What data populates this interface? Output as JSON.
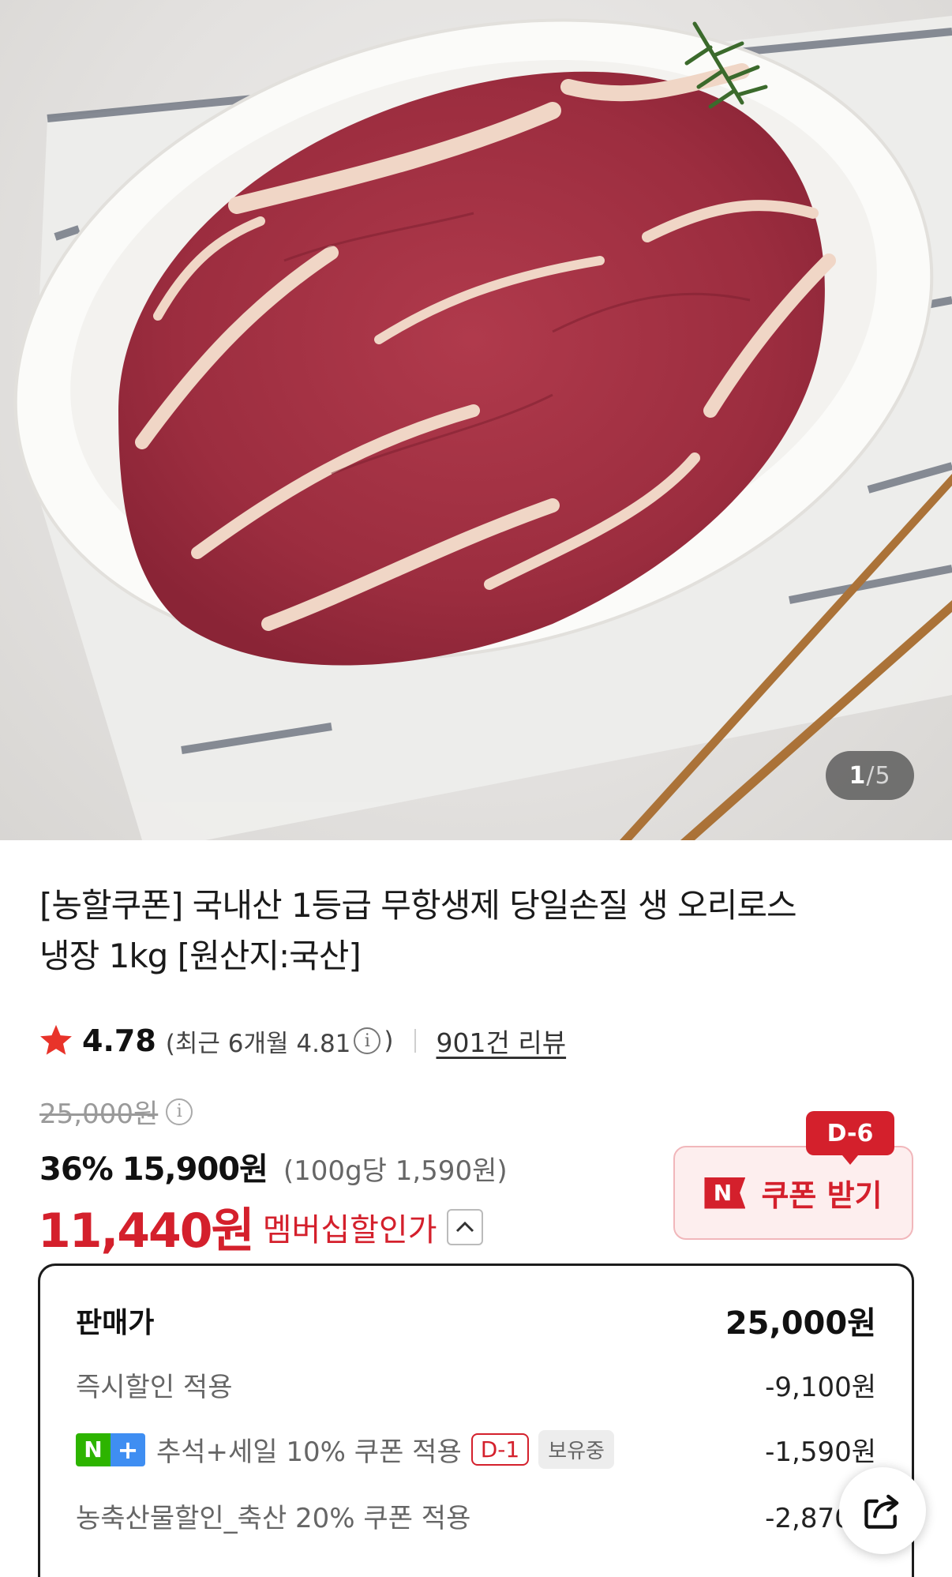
{
  "gallery": {
    "current": "1",
    "separator": "/",
    "total": "5"
  },
  "product": {
    "title_line1": "[농할쿠폰] 국내산 1등급 무항생제 당일손질 생 오리로스",
    "title_line2": "냉장 1kg [원산지:국산]"
  },
  "rating": {
    "score": "4.78",
    "recent_prefix": "(최근 6개월 4.81",
    "recent_suffix": ")",
    "info_glyph": "i",
    "reviews": "901건 리뷰"
  },
  "price": {
    "original": "25,000원",
    "discount_pct": "36%",
    "sale_price": "15,900원",
    "unit_price": "(100g당 1,590원)",
    "member_price": "11,440원",
    "member_label": "멤버십할인가"
  },
  "coupon": {
    "badge": "D-6",
    "logo": "N",
    "label": "쿠폰 받기"
  },
  "breakdown": {
    "rows": [
      {
        "label": "판매가",
        "value": "25,000원"
      },
      {
        "label": "즉시할인 적용",
        "value": "-9,100원"
      },
      {
        "label": "추석+세일 10% 쿠폰 적용",
        "value": "-1,590원",
        "badge": "D-1",
        "status": "보유중",
        "logo_n": "N",
        "logo_plus": "+"
      },
      {
        "label": "농축산물할인_축산 20% 쿠폰 적용",
        "value": "-2,870원"
      }
    ]
  },
  "colors": {
    "accent_red": "#d4202c",
    "star": "#e8332a",
    "naver_green": "#2db400",
    "plus_blue": "#3f8ef2"
  },
  "icons": {
    "rating": "star-icon",
    "info": "info-icon",
    "collapse": "chevron-up-icon",
    "share": "share-icon"
  }
}
